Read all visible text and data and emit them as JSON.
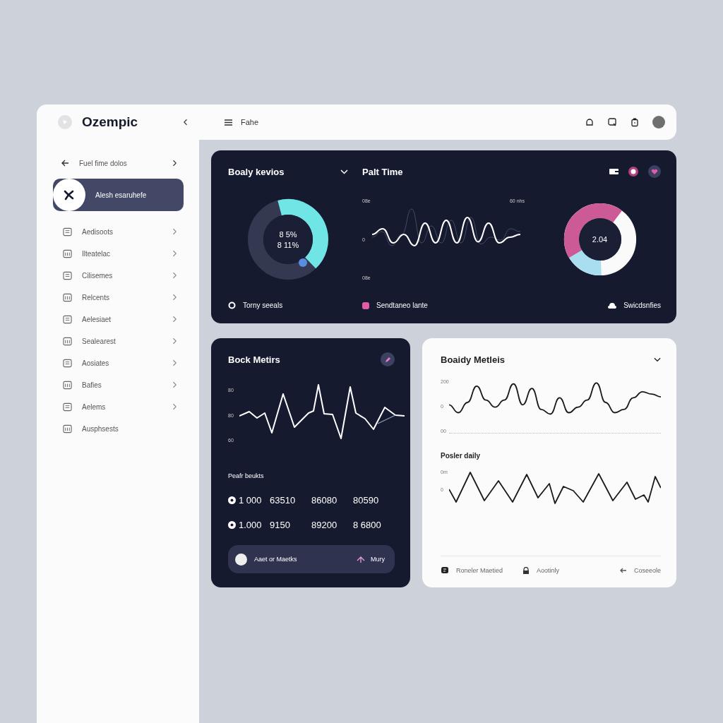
{
  "app": {
    "name": "Ozempic"
  },
  "topbar": {
    "title": "Fahe"
  },
  "sidebar": {
    "header": "Fuel fime dolos",
    "items": [
      {
        "label": "Alesh esaruhefe",
        "selected": true,
        "chevron": false
      },
      {
        "label": "Aedisoots",
        "selected": false,
        "chevron": true
      },
      {
        "label": "Ilteatelac",
        "selected": false,
        "chevron": true
      },
      {
        "label": "Cilisemes",
        "selected": false,
        "chevron": true
      },
      {
        "label": "Relcents",
        "selected": false,
        "chevron": true
      },
      {
        "label": "Aelesiaet",
        "selected": false,
        "chevron": true
      },
      {
        "label": "Sealearest",
        "selected": false,
        "chevron": true
      },
      {
        "label": "Aosiates",
        "selected": false,
        "chevron": true
      },
      {
        "label": "Bafies",
        "selected": false,
        "chevron": true
      },
      {
        "label": "Aelems",
        "selected": false,
        "chevron": true
      },
      {
        "label": "Ausphsests",
        "selected": false,
        "chevron": false
      }
    ]
  },
  "body_panel": {
    "title": "Boaly kevios",
    "center_lines": [
      "8 5%",
      "8 11%"
    ],
    "legend": "Torny seeals"
  },
  "pulse_panel": {
    "title": "Palt Time",
    "axis_top": "08e",
    "axis_right": "60 nhs",
    "axis_mid": "0",
    "axis_bottom": "08e",
    "legend": "Sendtaneo lante"
  },
  "ratio_panel": {
    "center": "2.04",
    "legend": "Swicdsnfies"
  },
  "block_card": {
    "title": "Bock Metirs",
    "axis_labels": [
      "80",
      "80",
      "60"
    ],
    "subtitle": "Peafr beukts",
    "rows": [
      {
        "cells": [
          "1 000",
          "63510",
          "86080",
          "80590"
        ]
      },
      {
        "cells": [
          "1.000",
          "9150",
          "89200",
          "8 6800"
        ]
      }
    ],
    "footer": {
      "label": "Aaet or Maetks",
      "action": "Mury"
    }
  },
  "metrics_card": {
    "title": "Boaidy Metleis",
    "chart1_labels": [
      "200",
      "0",
      "00"
    ],
    "subtitle": "Posler daily",
    "chart2_labels": [
      "0m",
      "0"
    ],
    "footer": [
      {
        "kind": "status",
        "label": "Roneler Maetied"
      },
      {
        "kind": "lock",
        "label": "Aootinly"
      },
      {
        "kind": "arrow",
        "label": "Coseeole"
      }
    ]
  }
}
